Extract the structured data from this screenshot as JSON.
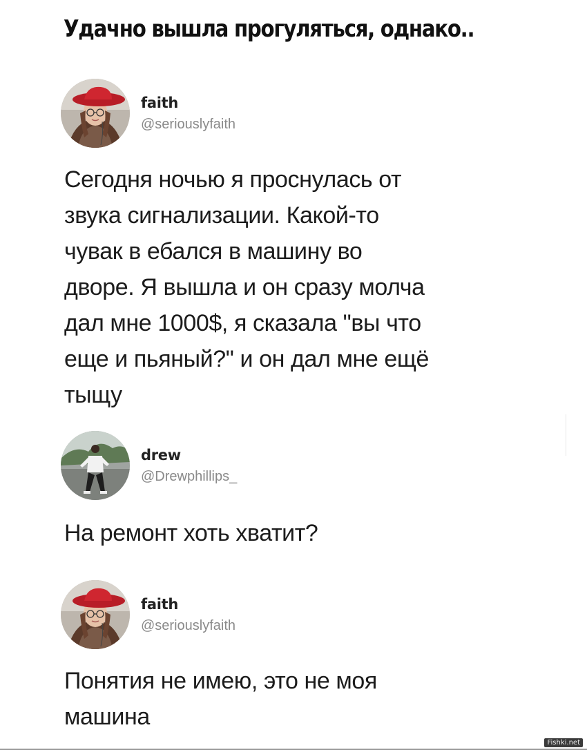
{
  "post": {
    "title": "Удачно вышла прогуляться, однако.."
  },
  "tweets": [
    {
      "name": "faith",
      "handle": "@seriouslyfaith",
      "text": "Сегодня ночью я проснулась от\nзвука сигнализации. Какой-то\nчувак в  ебался в машину во\nдворе. Я вышла и он сразу молча\nдал мне 1000$, я сказала \"вы что\nеще и пьяный?\" и он дал мне ещё\nтыщу",
      "avatar_icon": "avatar-woman-red-hat"
    },
    {
      "name": "drew",
      "handle": "@Drewphillips_",
      "text": "На ремонт хоть хватит?",
      "avatar_icon": "avatar-man-standing"
    },
    {
      "name": "faith",
      "handle": "@seriouslyfaith",
      "text": "Понятия не имею, это не моя\nмашина",
      "avatar_icon": "avatar-woman-red-hat"
    }
  ],
  "watermark": "Fishki.net",
  "colors": {
    "background": "#ffffff",
    "text": "#1c1c1c",
    "handle": "#8a8a8a",
    "hat_red": "#c0202a"
  }
}
